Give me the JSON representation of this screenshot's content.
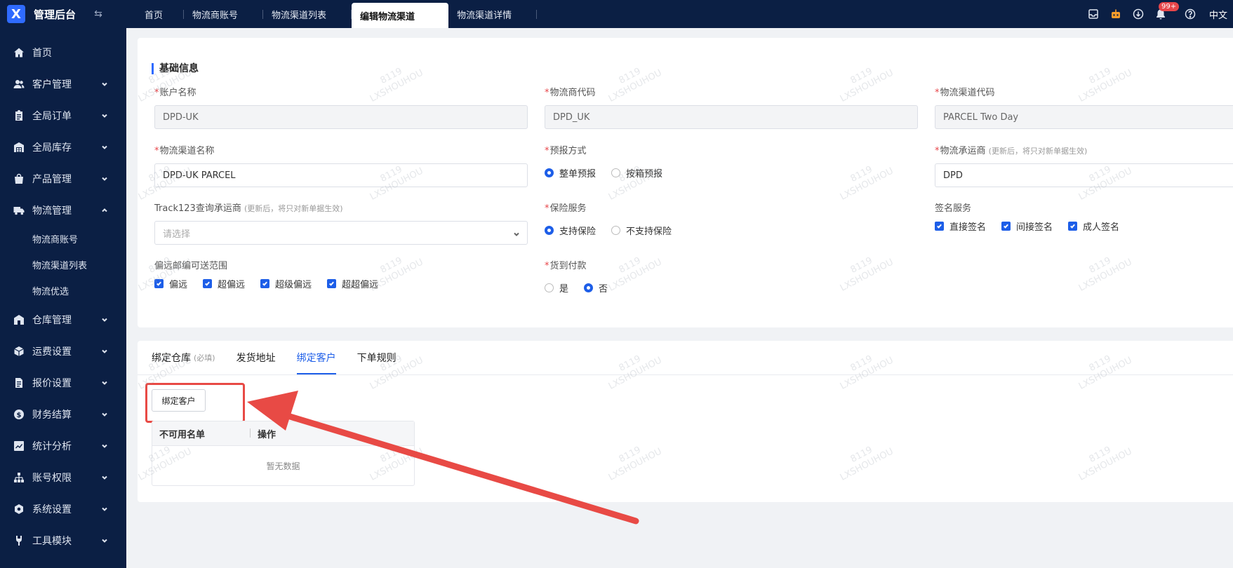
{
  "app": {
    "title": "管理后台",
    "logo_letter": "X"
  },
  "tabs": [
    {
      "label": "首页"
    },
    {
      "label": "物流商账号"
    },
    {
      "label": "物流渠道列表"
    },
    {
      "label": "编辑物流渠道"
    },
    {
      "label": "物流渠道详情"
    }
  ],
  "header": {
    "notification_count": "99+",
    "language": "中文"
  },
  "sidebar": {
    "items": [
      {
        "label": "首页"
      },
      {
        "label": "客户管理"
      },
      {
        "label": "全局订单"
      },
      {
        "label": "全局库存"
      },
      {
        "label": "产品管理"
      },
      {
        "label": "物流管理"
      },
      {
        "label": "仓库管理"
      },
      {
        "label": "运费设置"
      },
      {
        "label": "报价设置"
      },
      {
        "label": "财务结算"
      },
      {
        "label": "统计分析"
      },
      {
        "label": "账号权限"
      },
      {
        "label": "系统设置"
      },
      {
        "label": "工具模块"
      }
    ],
    "sub_items": [
      {
        "label": "物流商账号"
      },
      {
        "label": "物流渠道列表"
      },
      {
        "label": "物流优选"
      }
    ]
  },
  "form": {
    "section_title": "基础信息",
    "account_name": {
      "label": "账户名称",
      "value": "DPD-UK"
    },
    "carrier_code": {
      "label": "物流商代码",
      "value": "DPD_UK"
    },
    "channel_code": {
      "label": "物流渠道代码",
      "value": "PARCEL Two Day"
    },
    "channel_name": {
      "label": "物流渠道名称",
      "value": "DPD-UK PARCEL"
    },
    "forecast": {
      "label": "预报方式",
      "options": [
        "整单预报",
        "按箱预报"
      ]
    },
    "logistics_carrier": {
      "label": "物流承运商",
      "hint": "(更新后，将只对新单据生效)",
      "value": "DPD"
    },
    "track123": {
      "label": "Track123查询承运商",
      "hint": "(更新后，将只对新单据生效)",
      "placeholder": "请选择"
    },
    "insurance": {
      "label": "保险服务",
      "options": [
        "支持保险",
        "不支持保险"
      ]
    },
    "signature": {
      "label": "签名服务",
      "options": [
        "直接签名",
        "间接签名",
        "成人签名"
      ]
    },
    "remote": {
      "label": "偏远邮编可送范围",
      "options": [
        "偏远",
        "超偏远",
        "超级偏远",
        "超超偏远"
      ]
    },
    "cod": {
      "label": "货到付款",
      "options": [
        "是",
        "否"
      ]
    }
  },
  "bottom": {
    "tabs": [
      {
        "label": "绑定仓库",
        "small": "(必填)"
      },
      {
        "label": "发货地址"
      },
      {
        "label": "绑定客户"
      },
      {
        "label": "下单规则"
      }
    ],
    "bind_button": "绑定客户",
    "table": {
      "columns": [
        "不可用名单",
        "操作"
      ],
      "empty": "暂无数据"
    }
  },
  "watermark": {
    "line1": "8119",
    "line2": "LXSHOUHOU"
  },
  "colors": {
    "nav_bg": "#0b1f44",
    "accent": "#1d5ee8",
    "highlight": "#e84a45"
  }
}
